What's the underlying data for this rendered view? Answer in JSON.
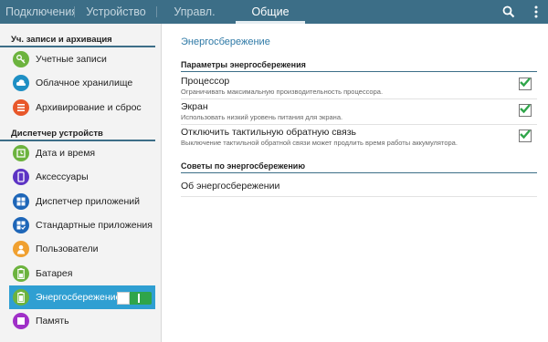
{
  "tabs": [
    {
      "label": "Подключения"
    },
    {
      "label": "Устройство"
    },
    {
      "label": "Управл."
    },
    {
      "label": "Общие"
    }
  ],
  "actions": {
    "search_icon": "search-icon",
    "more_icon": "overflow-menu-icon"
  },
  "sidebar": {
    "section1": {
      "title": "Уч. записи и архивация",
      "items": [
        {
          "label": "Учетные записи",
          "icon": "key-icon",
          "color": "#6cb33e"
        },
        {
          "label": "Облачное хранилище",
          "icon": "cloud-icon",
          "color": "#1e8fc4"
        },
        {
          "label": "Архивирование и сброс",
          "icon": "backup-icon",
          "color": "#e8572a"
        }
      ]
    },
    "section2": {
      "title": "Диспетчер устройств",
      "items": [
        {
          "label": "Дата и время",
          "icon": "clock-icon",
          "color": "#6cb33e"
        },
        {
          "label": "Аксессуары",
          "icon": "accessory-icon",
          "color": "#5d34c4"
        },
        {
          "label": "Диспетчер приложений",
          "icon": "apps-grid-icon",
          "color": "#1e66b8"
        },
        {
          "label": "Стандартные приложения",
          "icon": "default-apps-icon",
          "color": "#1e66b8"
        },
        {
          "label": "Пользователи",
          "icon": "user-icon",
          "color": "#f0a030"
        },
        {
          "label": "Батарея",
          "icon": "battery-icon",
          "color": "#6cb33e"
        },
        {
          "label": "Энергосбережение",
          "icon": "power-saving-icon",
          "color": "#6cb33e",
          "selected": true
        },
        {
          "label": "Память",
          "icon": "memory-icon",
          "color": "#a030c8"
        }
      ]
    }
  },
  "main": {
    "title": "Энергосбережение",
    "section1": "Параметры энергосбережения",
    "rows": [
      {
        "title": "Процессор",
        "subtitle": "Ограничивать максимальную производительность процессора.",
        "checked": true
      },
      {
        "title": "Экран",
        "subtitle": "Использовать низкий уровень питания для экрана.",
        "checked": true
      },
      {
        "title": "Отключить тактильную обратную связь",
        "subtitle": "Выключение тактильной обратной связи может продлить время работы аккумулятора.",
        "checked": true
      }
    ],
    "section2": "Советы по энергосбережению",
    "link": "Об энергосбережении"
  },
  "colors": {
    "accent": "#3c6e87",
    "selected": "#2f9fd2",
    "check": "#2fa54a",
    "title": "#2e79a6"
  }
}
